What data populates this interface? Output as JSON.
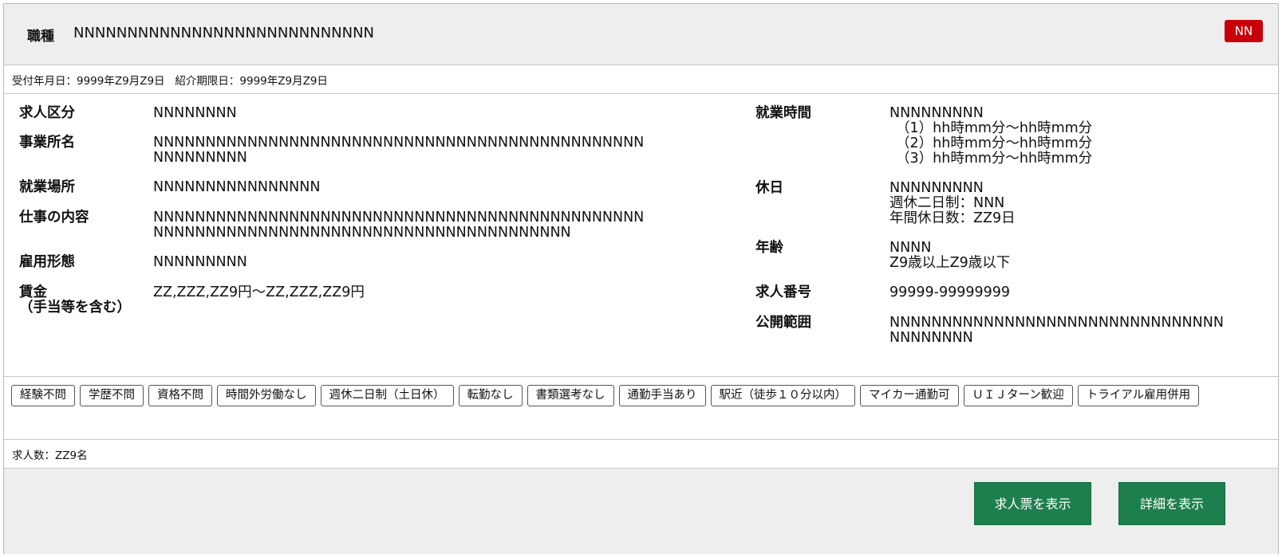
{
  "header": {
    "occupation_label": "職種",
    "occupation_value": "NNNNNNNNNNNNNNNNNNNNNNNNNNNN",
    "badge": "NN",
    "badge_color": "#c8000a"
  },
  "dates": {
    "received": "受付年月日：9999年Z9月Z9日",
    "deadline": "紹介期限日：9999年Z9月Z9日"
  },
  "left_info": {
    "category_label": "求人区分",
    "category_value": "NNNNNNNN",
    "office_label": "事業所名",
    "office_value_1": "NNNNNNNNNNNNNNNNNNNNNNNNNNNNNNNNNNNNNNNNNNNNNNN",
    "office_value_2": "NNNNNNNNN",
    "place_label": "就業場所",
    "place_value": "NNNNNNNNNNNNNNNN",
    "job_label": "仕事の内容",
    "job_value_1": "NNNNNNNNNNNNNNNNNNNNNNNNNNNNNNNNNNNNNNNNNNNNNNN",
    "job_value_2": "NNNNNNNNNNNNNNNNNNNNNNNNNNNNNNNNNNNNNNNN",
    "employment_label": "雇用形態",
    "employment_value": "NNNNNNNNN",
    "wage_label_1": "賃金",
    "wage_label_2": "（手当等を含む）",
    "wage_value": "ZZ,ZZZ,ZZ9円〜ZZ,ZZZ,ZZ9円"
  },
  "right_info": {
    "hours_label": "就業時間",
    "hours_value": "NNNNNNNNN",
    "hours_1": "（1）hh時mm分〜hh時mm分",
    "hours_2": "（2）hh時mm分〜hh時mm分",
    "hours_3": "（3）hh時mm分〜hh時mm分",
    "holiday_label": "休日",
    "holiday_value": "NNNNNNNNN",
    "holiday_weekly": "週休二日制：NNN",
    "holiday_annual": "年間休日数：ZZ9日",
    "age_label": "年齢",
    "age_value": "NNNN",
    "age_range": "Z9歳以上Z9歳以下",
    "number_label": "求人番号",
    "number_value": "99999-99999999",
    "scope_label": "公開範囲",
    "scope_value_1": "NNNNNNNNNNNNNNNNNNNNNNNNNNNNNNNN",
    "scope_value_2": "NNNNNNNN"
  },
  "tags": [
    "経験不問",
    "学歴不問",
    "資格不問",
    "時間外労働なし",
    "週休二日制（土日休）",
    "転勤なし",
    "書類選考なし",
    "通勤手当あり",
    "駅近（徒歩１０分以内）",
    "マイカー通勤可",
    "ＵＩＪターン歓迎",
    "トライアル雇用併用"
  ],
  "count": "求人数：ZZ9名",
  "buttons": {
    "job_sheet": "求人票を表示",
    "details": "詳細を表示",
    "button_color": "#1e7f4e"
  }
}
